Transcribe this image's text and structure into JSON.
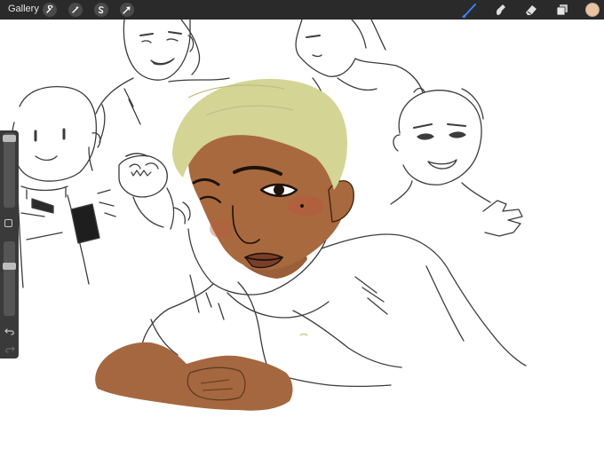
{
  "topbar": {
    "gallery_label": "Gallery",
    "left_tools": [
      "wrench-icon",
      "magic-wand-icon",
      "selection-icon",
      "transform-arrow-icon"
    ],
    "right_tools": [
      "brush-icon",
      "smudge-icon",
      "eraser-icon",
      "layers-icon"
    ],
    "active_color": "#e8c3a4",
    "active_tool_color": "#3b82f6"
  },
  "sidebar": {
    "brush_size_level": 0.03,
    "brush_opacity_level": 0.28,
    "controls": [
      "square-modify-icon",
      "undo-icon",
      "redo-icon"
    ]
  }
}
